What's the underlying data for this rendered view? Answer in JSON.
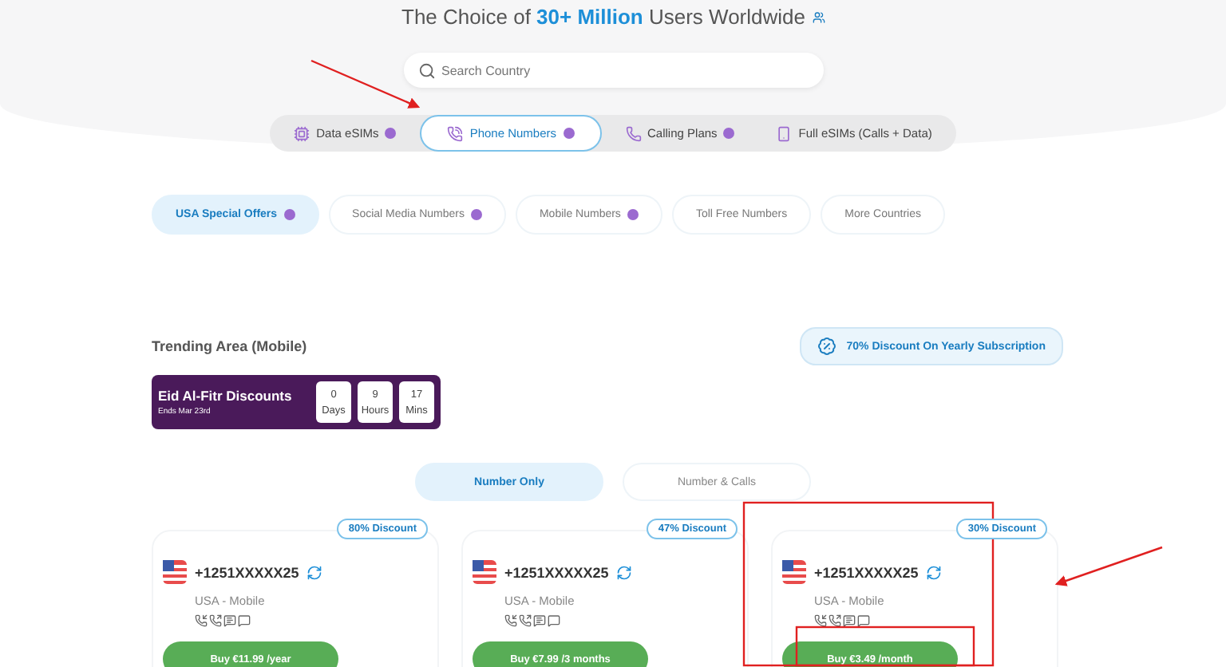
{
  "header": {
    "title": "The Choice of **30+ Million** Users Worldwide"
  },
  "search": {
    "placeholder": "Search Country"
  },
  "tabs": [
    {
      "label": "Data eSIMs",
      "selected": false,
      "kind": "data",
      "coin": true
    },
    {
      "label": "Phone Numbers",
      "selected": true,
      "kind": "phone",
      "coin": true
    },
    {
      "label": "Calling Plans",
      "selected": false,
      "kind": "calling",
      "coin": true
    },
    {
      "label": "Full eSIMs (Calls + Data)",
      "selected": false,
      "kind": "full",
      "coin": false
    }
  ],
  "sub_tabs": [
    {
      "label": "USA Special Offers",
      "selected": true,
      "coin": true
    },
    {
      "label": "Social Media Numbers",
      "selected": false,
      "coin": true
    },
    {
      "label": "Mobile Numbers",
      "selected": false,
      "coin": true
    },
    {
      "label": "Toll Free Numbers",
      "selected": false,
      "coin": false
    },
    {
      "label": "More Countries",
      "selected": false,
      "coin": false
    }
  ],
  "trending": {
    "title": "Trending Area (Mobile)",
    "promo": "70% Discount On Yearly Subscription",
    "countdown": {
      "title": "Eid Al-Fitr Discounts",
      "subtitle": "Ends Mar 23rd",
      "units": [
        {
          "value": "0",
          "label": "Days"
        },
        {
          "value": "9",
          "label": "Hours"
        },
        {
          "value": "17",
          "label": "Mins"
        }
      ]
    }
  },
  "plan_toggle": [
    {
      "label": "Number Only",
      "selected": true
    },
    {
      "label": "Number & Calls",
      "selected": false
    }
  ],
  "cards": [
    {
      "discount": "80% Discount",
      "number": "+1251XXXXX25",
      "type": "USA - Mobile",
      "button": "Buy €11.99 /year"
    },
    {
      "discount": "47% Discount",
      "number": "+1251XXXXX25",
      "type": "USA - Mobile",
      "button": "Buy €7.99 /3 months"
    },
    {
      "discount": "30% Discount",
      "number": "+1251XXXXX25",
      "type": "USA - Mobile",
      "button": "Buy €3.49 /month"
    }
  ]
}
